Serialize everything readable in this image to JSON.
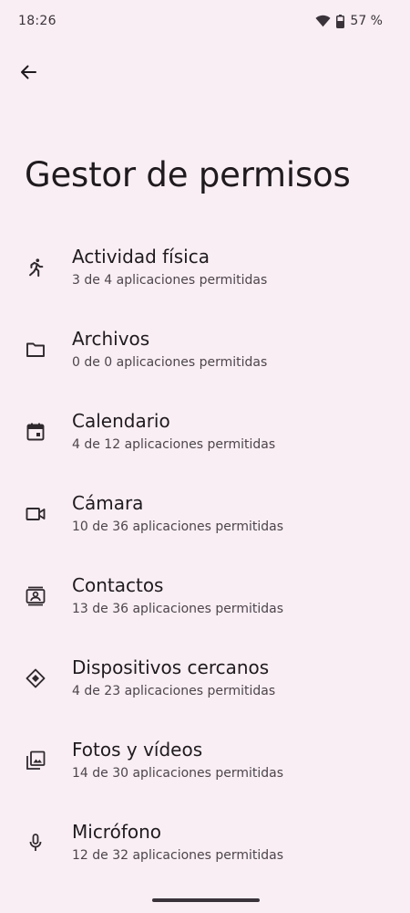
{
  "status_bar": {
    "time": "18:26",
    "battery_percent": "57 %",
    "icons": [
      "wifi-icon",
      "battery-icon"
    ]
  },
  "toolbar": {
    "back_icon": "arrow-back-icon"
  },
  "page": {
    "title": "Gestor de permisos"
  },
  "permissions": [
    {
      "icon": "running-person-icon",
      "label": "Actividad física",
      "summary": "3 de 4 aplicaciones permitidas"
    },
    {
      "icon": "folder-icon",
      "label": "Archivos",
      "summary": "0 de 0 aplicaciones permitidas"
    },
    {
      "icon": "calendar-icon",
      "label": "Calendario",
      "summary": "4 de 12 aplicaciones permitidas"
    },
    {
      "icon": "video-camera-icon",
      "label": "Cámara",
      "summary": "10 de 36 aplicaciones permitidas"
    },
    {
      "icon": "contact-card-icon",
      "label": "Contactos",
      "summary": "13 de 36 aplicaciones permitidas"
    },
    {
      "icon": "nearby-devices-icon",
      "label": "Dispositivos cercanos",
      "summary": "4 de 23 aplicaciones permitidas"
    },
    {
      "icon": "photo-library-icon",
      "label": "Fotos y vídeos",
      "summary": "14 de 30 aplicaciones permitidas"
    },
    {
      "icon": "microphone-icon",
      "label": "Micrófono",
      "summary": "12 de 32 aplicaciones permitidas"
    }
  ],
  "colors": {
    "background": "#f8eef4",
    "text_primary": "#1f1a1e",
    "text_secondary": "#4d454b"
  }
}
